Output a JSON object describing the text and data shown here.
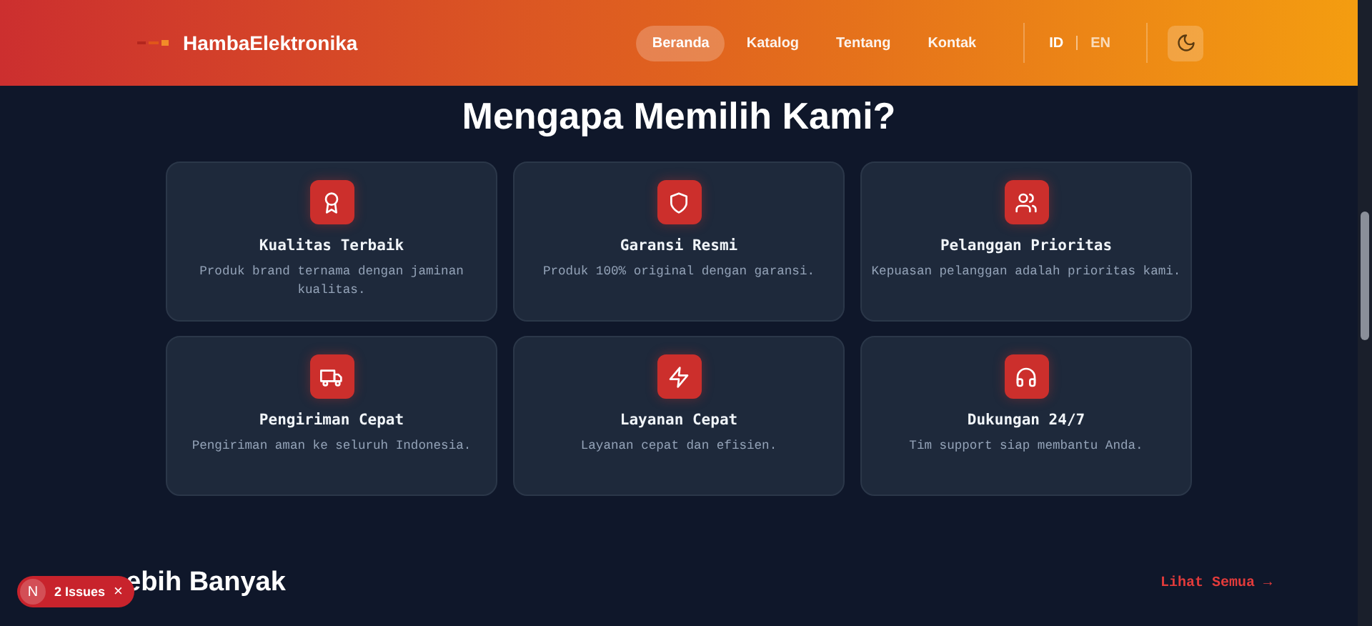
{
  "header": {
    "brand": "HambaElektronika",
    "nav": [
      {
        "label": "Beranda",
        "selected": true
      },
      {
        "label": "Katalog",
        "selected": false
      },
      {
        "label": "Tentang",
        "selected": false
      },
      {
        "label": "Kontak",
        "selected": false
      }
    ],
    "languages": [
      {
        "label": "ID",
        "selected": true
      },
      {
        "label": "EN",
        "selected": false
      }
    ]
  },
  "section_title": "Mengapa Memilih Kami?",
  "features": [
    {
      "title": "Kualitas Terbaik",
      "description": "Produk brand ternama dengan jaminan kualitas."
    },
    {
      "title": "Garansi Resmi",
      "description": "Produk 100% original dengan garansi."
    },
    {
      "title": "Pelanggan Prioritas",
      "description": "Kepuasan pelanggan adalah prioritas kami."
    },
    {
      "title": "Pengiriman Cepat",
      "description": "Pengiriman aman ke seluruh Indonesia."
    },
    {
      "title": "Layanan Cepat",
      "description": "Layanan cepat dan efisien."
    },
    {
      "title": "Dukungan 24/7",
      "description": "Tim support siap membantu Anda."
    }
  ],
  "next_section": {
    "title": "ebih Banyak",
    "link": "Lihat Semua →"
  },
  "issues_badge": {
    "letter": "N",
    "label": "2 Issues",
    "close": "×"
  }
}
